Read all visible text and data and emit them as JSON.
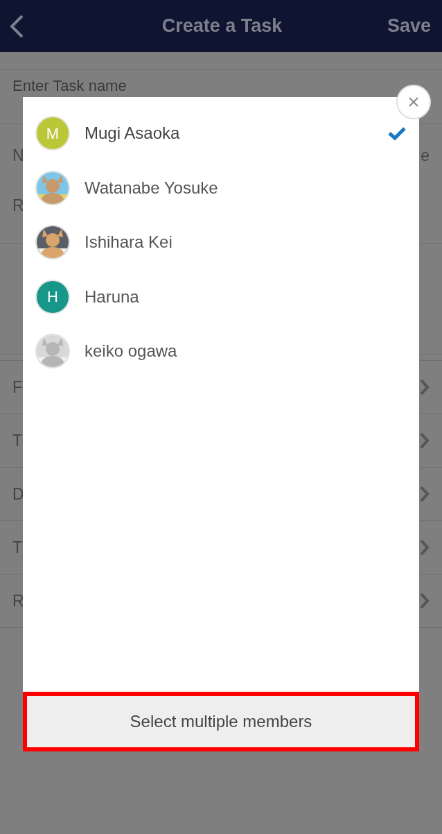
{
  "header": {
    "title": "Create a Task",
    "save": "Save"
  },
  "form": {
    "task_name_placeholder": "Enter Task name",
    "rows": [
      {
        "kind": "split",
        "left": "N",
        "right": "e"
      },
      {
        "kind": "plain",
        "left": "R"
      },
      {
        "kind": "spacer"
      },
      {
        "kind": "link",
        "left": "F"
      },
      {
        "kind": "link",
        "left": "T"
      },
      {
        "kind": "link",
        "left": "D"
      },
      {
        "kind": "link",
        "left": "T"
      },
      {
        "kind": "link",
        "left": "R"
      }
    ]
  },
  "dialog": {
    "members": [
      {
        "name": "Mugi Asaoka",
        "selected": true,
        "avatar": {
          "kind": "initial",
          "letter": "M",
          "color": "#bcc737"
        }
      },
      {
        "name": "Watanabe Yosuke",
        "selected": false
      },
      {
        "name": "Ishihara Kei",
        "selected": false
      },
      {
        "name": "Haruna",
        "selected": false,
        "avatar": {
          "kind": "initial",
          "letter": "H",
          "color": "#17968a"
        }
      },
      {
        "name": "keiko ogawa",
        "selected": false
      }
    ],
    "multi_button": "Select multiple members",
    "multi_button_highlighted": true
  }
}
